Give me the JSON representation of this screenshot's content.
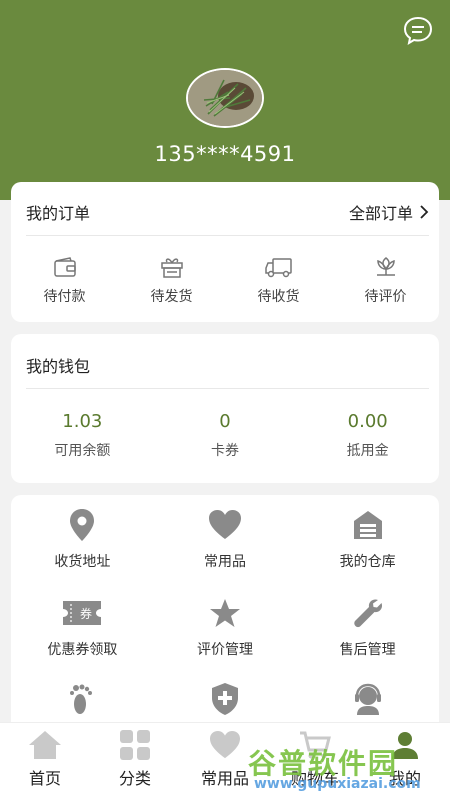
{
  "profile": {
    "phone": "135****4591",
    "avatar_alt": "",
    "message_icon": "message-bubble-icon"
  },
  "orders": {
    "title": "我的订单",
    "all_link": "全部订单",
    "items": [
      {
        "label": "待付款",
        "icon": "wallet-icon"
      },
      {
        "label": "待发货",
        "icon": "gift-box-icon"
      },
      {
        "label": "待收货",
        "icon": "truck-icon"
      },
      {
        "label": "待评价",
        "icon": "flower-icon"
      }
    ]
  },
  "wallet": {
    "title": "我的钱包",
    "items": [
      {
        "value": "1.03",
        "label": "可用余额"
      },
      {
        "value": "0",
        "label": "卡券"
      },
      {
        "value": "0.00",
        "label": "抵用金"
      }
    ]
  },
  "services": {
    "rows": [
      [
        {
          "label": "收货地址",
          "icon": "location-pin-icon"
        },
        {
          "label": "常用品",
          "icon": "heart-icon"
        },
        {
          "label": "我的仓库",
          "icon": "warehouse-icon"
        }
      ],
      [
        {
          "label": "优惠券领取",
          "icon": "coupon-icon"
        },
        {
          "label": "评价管理",
          "icon": "star-icon"
        },
        {
          "label": "售后管理",
          "icon": "wrench-icon"
        }
      ],
      [
        {
          "label": "",
          "icon": "footprint-icon"
        },
        {
          "label": "",
          "icon": "shield-plus-icon"
        },
        {
          "label": "",
          "icon": "customer-service-icon"
        }
      ]
    ],
    "coupon_badge": "券"
  },
  "tabbar": {
    "tabs": [
      {
        "label": "首页",
        "icon": "home-icon"
      },
      {
        "label": "分类",
        "icon": "grid-icon"
      },
      {
        "label": "常用品",
        "icon": "heart-icon"
      },
      {
        "label": "购物车",
        "icon": "cart-icon"
      },
      {
        "label": "我的",
        "icon": "user-icon"
      }
    ]
  },
  "watermark": {
    "title": "谷普软件园",
    "url": "www.gupuxiazai.com"
  },
  "colors": {
    "brand": "#6a8a3e",
    "accent_text": "#5a7a2e",
    "icon_gray": "#8a8a8a"
  }
}
